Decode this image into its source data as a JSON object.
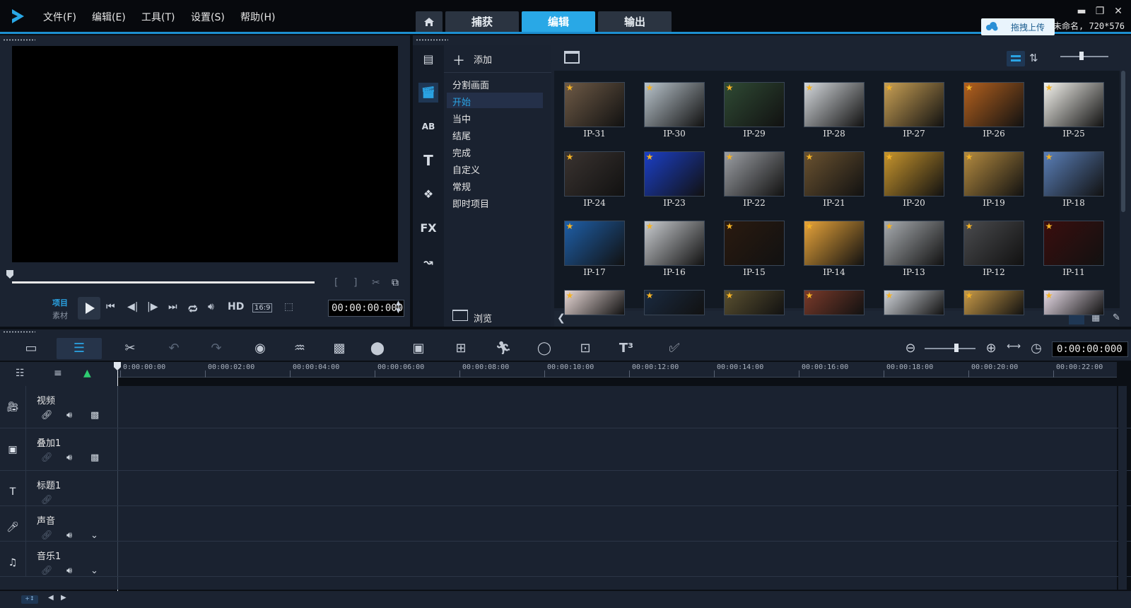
{
  "menu": [
    "文件(F)",
    "编辑(E)",
    "工具(T)",
    "设置(S)",
    "帮助(H)"
  ],
  "tabs": [
    "捕获",
    "编辑",
    "输出"
  ],
  "upload_label": "拖拽上传",
  "project_info": "未命名, 720*576",
  "player": {
    "project_label": "项目",
    "clip_label": "素材",
    "hd_label": "HD",
    "aspect_label": "16:9",
    "timecode": "00:00:00:000"
  },
  "library": {
    "add_label": "添加",
    "browse_label": "浏览",
    "categories": [
      "分割画面",
      "开始",
      "当中",
      "结尾",
      "完成",
      "自定义",
      "常规",
      "即时项目"
    ],
    "selected_category": "开始",
    "thumbs": [
      {
        "label": "IP-31",
        "color": "#6e5a46"
      },
      {
        "label": "IP-30",
        "color": "#b9c4cc"
      },
      {
        "label": "IP-29",
        "color": "#2f4a34"
      },
      {
        "label": "IP-28",
        "color": "#d5d9dd"
      },
      {
        "label": "IP-27",
        "color": "#caa155"
      },
      {
        "label": "IP-26",
        "color": "#b4611e"
      },
      {
        "label": "IP-25",
        "color": "#f5f4ee"
      },
      {
        "label": "IP-24",
        "color": "#3a3330"
      },
      {
        "label": "IP-23",
        "color": "#1b3fc6"
      },
      {
        "label": "IP-22",
        "color": "#9c9fa4"
      },
      {
        "label": "IP-21",
        "color": "#6a5230"
      },
      {
        "label": "IP-20",
        "color": "#c7952d"
      },
      {
        "label": "IP-19",
        "color": "#b48b40"
      },
      {
        "label": "IP-18",
        "color": "#5a7fb8"
      },
      {
        "label": "IP-17",
        "color": "#1e5fa8"
      },
      {
        "label": "IP-16",
        "color": "#c9ccd0"
      },
      {
        "label": "IP-15",
        "color": "#2a1a10"
      },
      {
        "label": "IP-14",
        "color": "#e8a43a"
      },
      {
        "label": "IP-13",
        "color": "#a8acb0"
      },
      {
        "label": "IP-12",
        "color": "#4a4b4e"
      },
      {
        "label": "IP-11",
        "color": "#3a0e0e"
      },
      {
        "label": "",
        "color": "#e8d8d6"
      },
      {
        "label": "",
        "color": "#1a2a40"
      },
      {
        "label": "",
        "color": "#5a5030"
      },
      {
        "label": "",
        "color": "#7a3a2a"
      },
      {
        "label": "",
        "color": "#d0d4da"
      },
      {
        "label": "",
        "color": "#c89a48"
      },
      {
        "label": "",
        "color": "#e8dce8"
      }
    ]
  },
  "timeline": {
    "timecode": "0:00:00:000",
    "ruler": [
      "0:00:00:00",
      "00:00:02:00",
      "00:00:04:00",
      "00:00:06:00",
      "00:00:08:00",
      "00:00:10:00",
      "00:00:12:00",
      "00:00:14:00",
      "00:00:16:00",
      "00:00:18:00",
      "00:00:20:00",
      "00:00:22:00"
    ],
    "tracks": [
      "视频",
      "叠加1",
      "标题1",
      "声音",
      "音乐1"
    ]
  }
}
